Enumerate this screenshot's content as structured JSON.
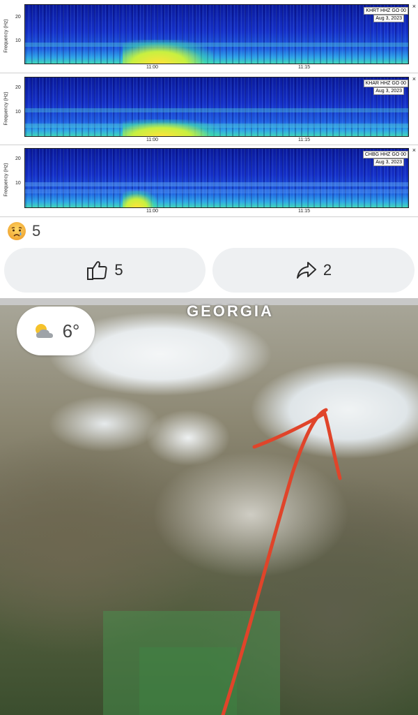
{
  "spectrograms": [
    {
      "station": "KHRT HHZ GO 00",
      "date": "Aug 3, 2023",
      "ylabel": "Frequency (Hz)",
      "yticks": [
        "20",
        "10"
      ],
      "xticks": [
        "11:00",
        "11:15"
      ],
      "close": "×"
    },
    {
      "station": "KHAR HHZ GO 00",
      "date": "Aug 3, 2023",
      "ylabel": "Frequency (Hz)",
      "yticks": [
        "20",
        "10"
      ],
      "xticks": [
        "11:00",
        "11:15"
      ],
      "close": "×"
    },
    {
      "station": "CHBG HHZ GO 00",
      "date": "Aug 3, 2023",
      "ylabel": "Frequency (Hz)",
      "yticks": [
        "20",
        "10"
      ],
      "xticks": [
        "11:00",
        "11:15"
      ],
      "close": "×"
    }
  ],
  "reactions": {
    "icon": "sad-tear-emoji",
    "count": "5"
  },
  "actions": {
    "like": {
      "icon": "thumbs-up-icon",
      "count": "5"
    },
    "share": {
      "icon": "share-arrow-icon",
      "count": "2"
    }
  },
  "map": {
    "region_label": "GEORGIA",
    "weather": {
      "icon": "partly-cloudy-icon",
      "temperature": "6°"
    },
    "route_color": "#e0442a"
  }
}
